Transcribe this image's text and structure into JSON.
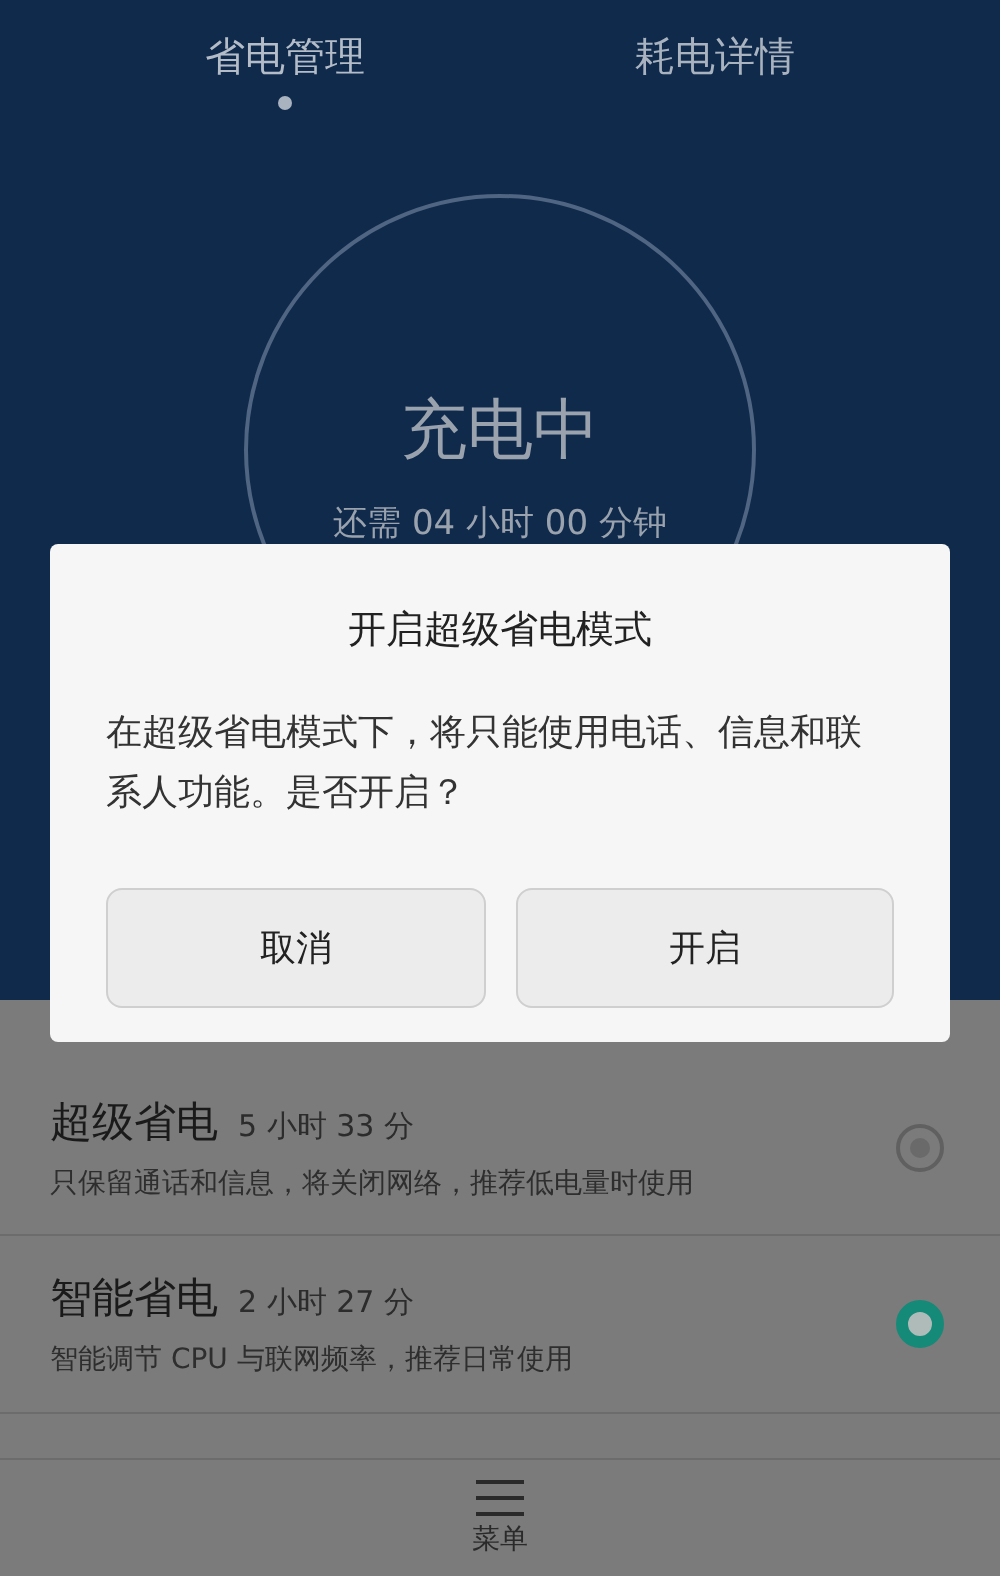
{
  "tabs": [
    {
      "label": "省电管理",
      "selected": true
    },
    {
      "label": "耗电详情",
      "selected": false
    }
  ],
  "status": {
    "title": "充电中",
    "remaining": "还需 04 小时 00 分钟"
  },
  "modes": [
    {
      "name": "超级省电",
      "duration": "5 小时 33 分",
      "description": "只保留通话和信息，将关闭网络，推荐低电量时使用",
      "selected": false
    },
    {
      "name": "智能省电",
      "duration": "2 小时 27 分",
      "description": "智能调节 CPU 与联网频率，推荐日常使用",
      "selected": true
    }
  ],
  "bottom_bar": {
    "menu_label": "菜单"
  },
  "dialog": {
    "title": "开启超级省电模式",
    "message": "在超级省电模式下，将只能使用电话、信息和联系人功能。是否开启？",
    "buttons": [
      "取消",
      "开启"
    ]
  }
}
